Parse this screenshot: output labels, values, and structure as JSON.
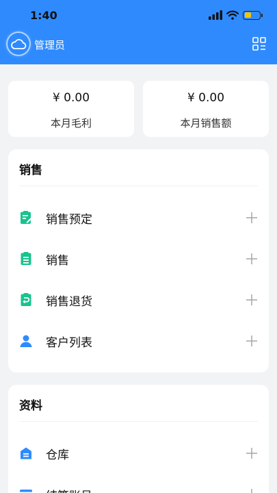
{
  "status_bar": {
    "time": "1:40"
  },
  "header": {
    "user_name": "管理员"
  },
  "summary": [
    {
      "value": "¥ 0.00",
      "label": "本月毛利"
    },
    {
      "value": "¥ 0.00",
      "label": "本月销售额"
    }
  ],
  "sections": [
    {
      "title": "销售",
      "items": [
        {
          "label": "销售预定",
          "icon": "clipboard-edit-icon",
          "color": "#19c38e"
        },
        {
          "label": "销售",
          "icon": "clipboard-list-icon",
          "color": "#19c38e"
        },
        {
          "label": "销售退货",
          "icon": "clipboard-return-icon",
          "color": "#19c38e"
        },
        {
          "label": "客户列表",
          "icon": "user-icon",
          "color": "#2f8bfd"
        }
      ]
    },
    {
      "title": "资料",
      "items": [
        {
          "label": "仓库",
          "icon": "warehouse-icon",
          "color": "#2f8bfd"
        },
        {
          "label": "结算账号",
          "icon": "account-icon",
          "color": "#2f8bfd"
        }
      ]
    }
  ],
  "colors": {
    "primary": "#2f8bfd",
    "green": "#19c38e",
    "background": "#f2f3f5"
  }
}
